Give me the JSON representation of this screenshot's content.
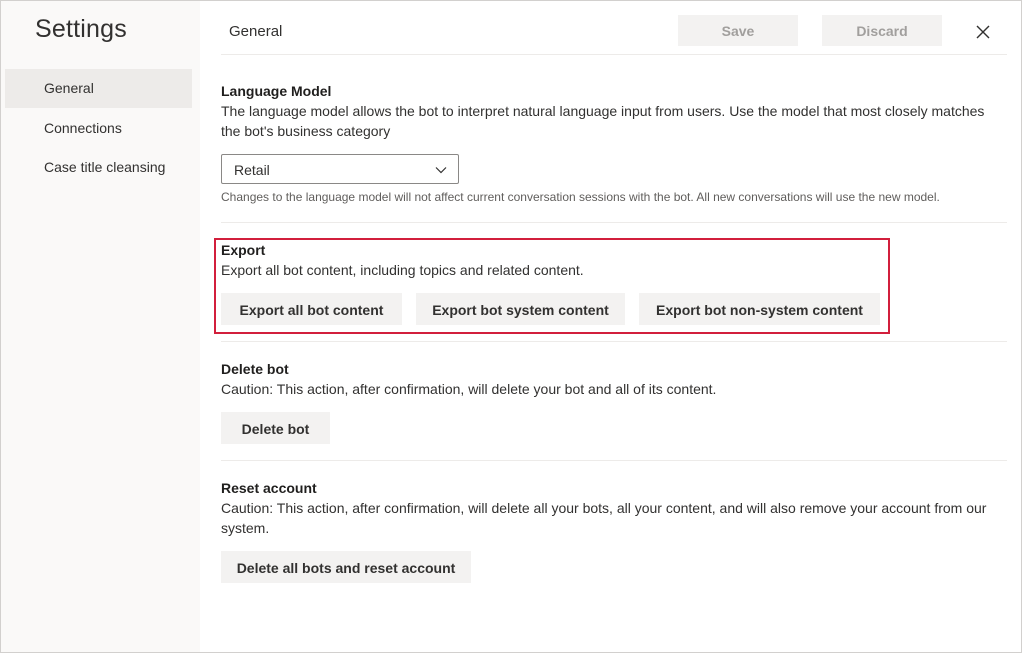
{
  "sidebar": {
    "title": "Settings",
    "items": [
      {
        "label": "General",
        "active": true
      },
      {
        "label": "Connections",
        "active": false
      },
      {
        "label": "Case title cleansing",
        "active": false
      }
    ]
  },
  "header": {
    "title": "General",
    "save_label": "Save",
    "discard_label": "Discard",
    "close_icon": "close-icon"
  },
  "language_model": {
    "title": "Language Model",
    "description": "The language model allows the bot to interpret natural language input from users. Use the model that most closely matches the bot's business category",
    "selected": "Retail",
    "hint": "Changes to the language model will not affect current conversation sessions with the bot. All new conversations will use the new model."
  },
  "export": {
    "title": "Export",
    "description": "Export all bot content, including topics and related content.",
    "buttons": [
      "Export all bot content",
      "Export bot system content",
      "Export bot non-system content"
    ]
  },
  "delete_bot": {
    "title": "Delete bot",
    "description": "Caution: This action, after confirmation, will delete your bot and all of its content.",
    "button": "Delete bot"
  },
  "reset_account": {
    "title": "Reset account",
    "description": "Caution: This action, after confirmation, will delete all your bots, all your content, and will also remove your account from our system.",
    "button": "Delete all bots and reset account"
  },
  "colors": {
    "highlight": "#d21f3c",
    "sidebar_bg": "#faf9f8",
    "button_bg": "#f3f2f1"
  }
}
